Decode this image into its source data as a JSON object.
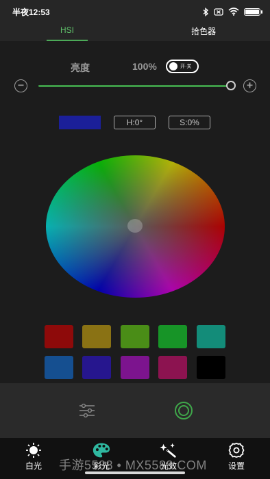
{
  "status_bar": {
    "time": "半夜12:53"
  },
  "tabs": [
    {
      "label": "HSI",
      "active": true
    },
    {
      "label": "拾色器",
      "active": false
    }
  ],
  "brightness": {
    "label": "亮度",
    "value": "100%",
    "toggle_label": "开·关",
    "slider_value": 1.0
  },
  "color_info": {
    "preview_color": "#1b1f99",
    "hue": "H:0°",
    "saturation": "S:0%"
  },
  "swatches": [
    {
      "color": "#8e0a0a"
    },
    {
      "color": "#8a7214"
    },
    {
      "color": "#4a8d17"
    },
    {
      "color": "#179427"
    },
    {
      "color": "#138c79"
    },
    {
      "color": "#154f90"
    },
    {
      "color": "#26168e"
    },
    {
      "color": "#7c148e"
    },
    {
      "color": "#8c1350"
    },
    {
      "color": "#000000"
    }
  ],
  "bottom_nav": [
    {
      "label": "白光",
      "icon": "sun-icon"
    },
    {
      "label": "彩光",
      "icon": "palette-icon"
    },
    {
      "label": "光效",
      "icon": "sparkle-wand-icon"
    },
    {
      "label": "设置",
      "icon": "gear-icon"
    }
  ],
  "watermark": "手游5588 • MX5588.COM",
  "colors": {
    "accent": "#4caa58",
    "background": "#1c1c1c"
  }
}
